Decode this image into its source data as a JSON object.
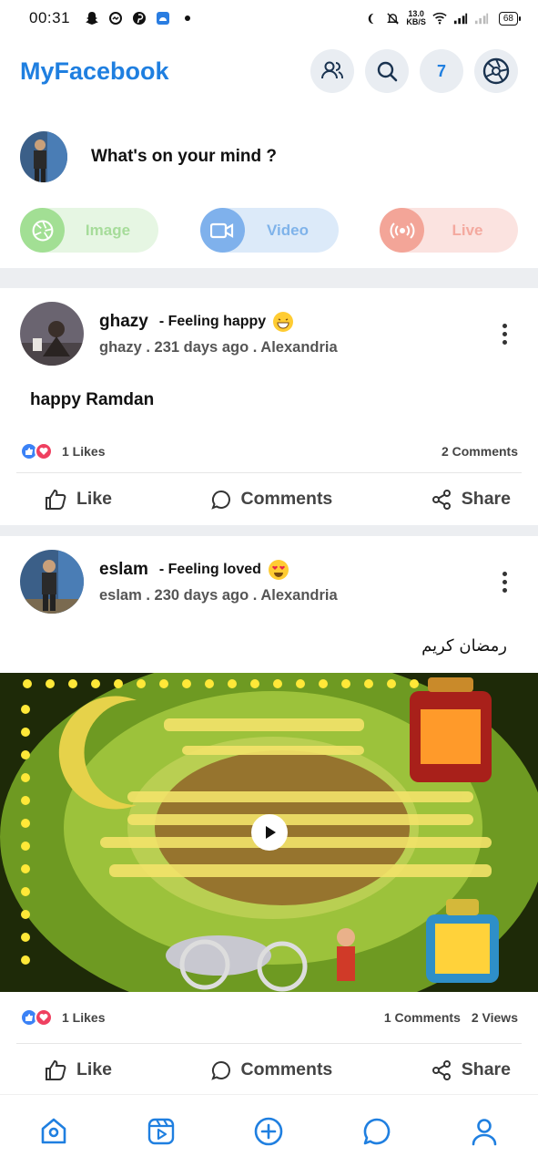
{
  "status_bar": {
    "time": "00:31",
    "net_speed_value": "13.0",
    "net_speed_unit": "KB/S",
    "battery": "68"
  },
  "header": {
    "title": "MyFacebook",
    "notification_count": "7"
  },
  "composer": {
    "prompt": "What's on your mind ?",
    "image_label": "Image",
    "video_label": "Video",
    "live_label": "Live"
  },
  "posts": [
    {
      "author": "ghazy",
      "feeling": "- Feeling happy",
      "meta": "ghazy  .  231 days ago . Alexandria",
      "text": "happy Ramdan",
      "likes": "1 Likes",
      "comments": "2 Comments",
      "actions": {
        "like": "Like",
        "comments": "Comments",
        "share": "Share"
      }
    },
    {
      "author": "eslam",
      "feeling": "- Feeling loved",
      "meta": "eslam  .  230 days ago . Alexandria",
      "text": "رمضان كريم",
      "likes": "1 Likes",
      "comments": "1 Comments",
      "views": "2 Views",
      "actions": {
        "like": "Like",
        "comments": "Comments",
        "share": "Share"
      }
    }
  ],
  "colors": {
    "brand": "#1f7fe0",
    "image_accent": "#a2df94",
    "video_accent": "#7fb1ec",
    "live_accent": "#f3a598"
  }
}
